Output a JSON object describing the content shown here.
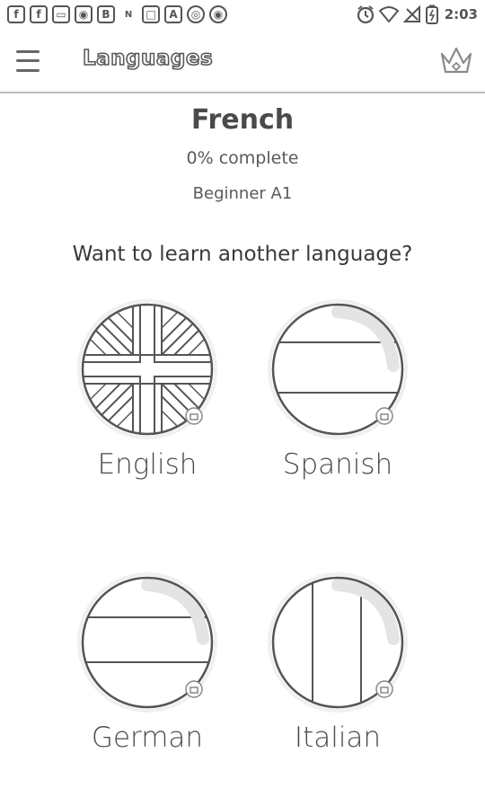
{
  "statusbar": {
    "left_icons": [
      "f",
      "f",
      "▭",
      "◉",
      "B",
      "N",
      "□",
      "A",
      "◎",
      "◉"
    ],
    "time": "2:03"
  },
  "toolbar": {
    "title": "Languages",
    "menu_icon": "hamburger-menu-icon",
    "premium_icon": "crown-icon"
  },
  "current": {
    "name": "French",
    "progress": "0% complete",
    "level": "Beginner A1"
  },
  "prompt": "Want to learn another language?",
  "languages": [
    {
      "label": "English",
      "icon": "uk-flag-icon"
    },
    {
      "label": "Spanish",
      "icon": "spain-flag-icon"
    },
    {
      "label": "German",
      "icon": "germany-flag-icon"
    },
    {
      "label": "Italian",
      "icon": "italy-flag-icon"
    }
  ]
}
